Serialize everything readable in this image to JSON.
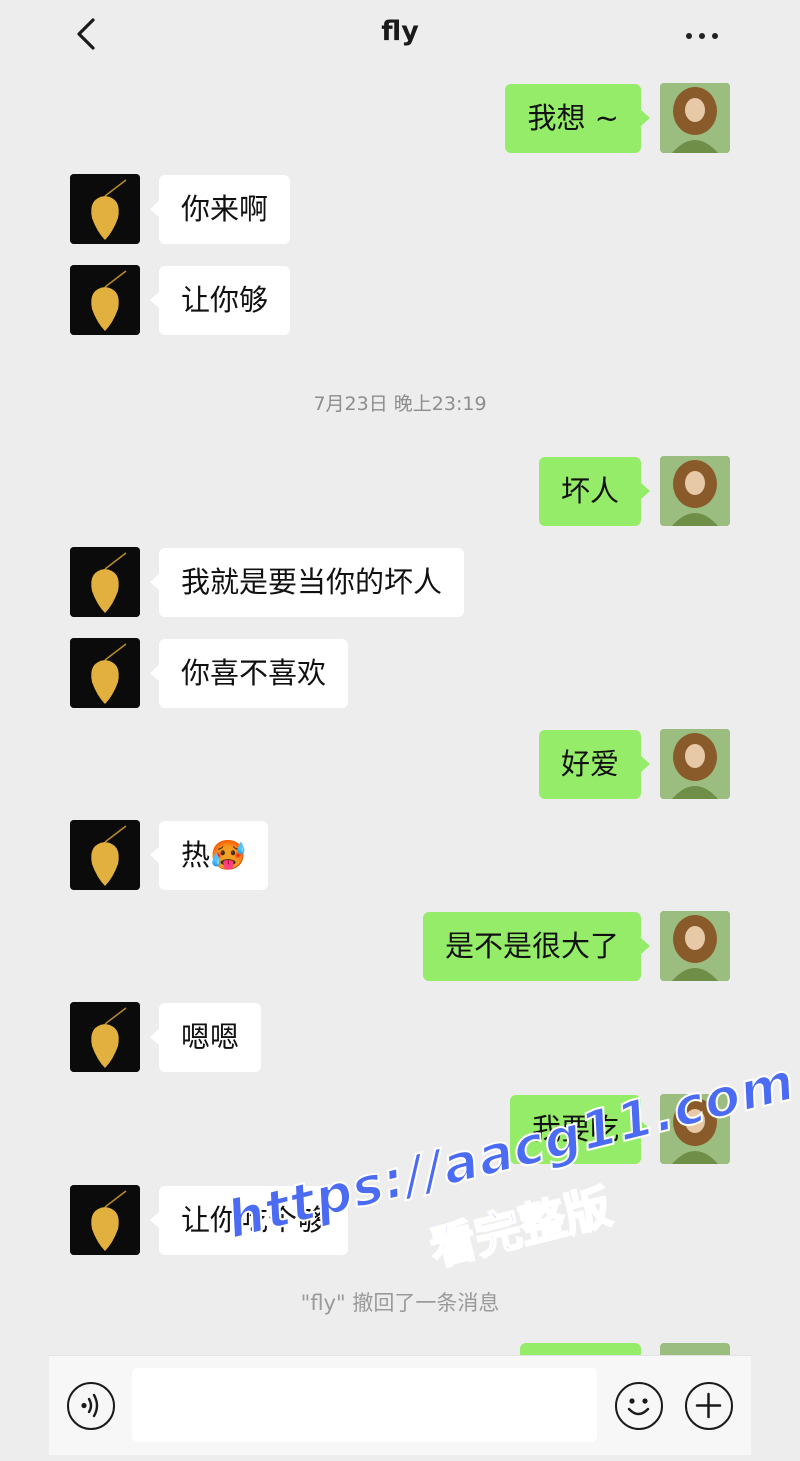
{
  "header": {
    "title": "fly",
    "back_icon": "chevron-left-icon",
    "more_icon": "more-dots-icon"
  },
  "timestamp": "7月23日 晚上23:19",
  "recall_notice": "\"fly\" 撤回了一条消息",
  "messages": [
    {
      "side": "out",
      "text": "我想 ~"
    },
    {
      "side": "in",
      "text": "你来啊"
    },
    {
      "side": "in",
      "text": "让你够"
    },
    {
      "side": "out",
      "text": "坏人"
    },
    {
      "side": "in",
      "text": "我就是要当你的坏人"
    },
    {
      "side": "in",
      "text": "你喜不喜欢"
    },
    {
      "side": "out",
      "text": "好爱"
    },
    {
      "side": "in",
      "text": "热🥵"
    },
    {
      "side": "out",
      "text": "是不是很大了"
    },
    {
      "side": "in",
      "text": "嗯嗯"
    },
    {
      "side": "out",
      "text": "我要吃"
    },
    {
      "side": "in",
      "text": "让你吃个够"
    }
  ],
  "input_bar": {
    "voice_icon": "voice-icon",
    "emoji_icon": "emoji-icon",
    "plus_icon": "plus-icon"
  },
  "watermark": {
    "url": "https://aacg11.com",
    "sub": "看完整版"
  },
  "colors": {
    "background": "#ededed",
    "outgoing_bubble": "#95ec69",
    "incoming_bubble": "#ffffff",
    "watermark": "#4b6cf2"
  }
}
